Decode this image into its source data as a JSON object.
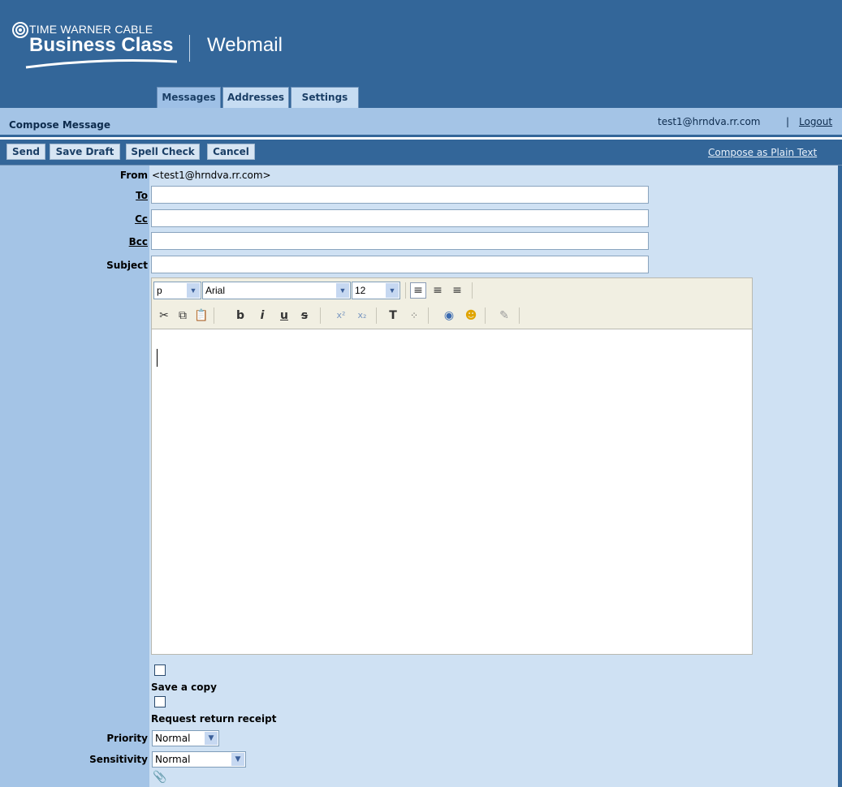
{
  "brand": {
    "line1": "TIME WARNER CABLE",
    "line2": "Business Class",
    "product": "Webmail"
  },
  "tabs": [
    {
      "label": "Messages",
      "active": true
    },
    {
      "label": "Addresses",
      "active": false
    },
    {
      "label": "Settings",
      "active": false
    }
  ],
  "titlebar": {
    "title": "Compose Message",
    "user": "test1@hrndva.rr.com",
    "separator": "|",
    "logout": "Logout"
  },
  "actions": {
    "send": "Send",
    "save_draft": "Save Draft",
    "spell_check": "Spell Check",
    "cancel": "Cancel",
    "plain_text": "Compose as Plain Text"
  },
  "form": {
    "from_label": "From",
    "from_value": "<test1@hrndva.rr.com>",
    "to_label": "To",
    "to_value": "",
    "cc_label": "Cc",
    "cc_value": "",
    "bcc_label": "Bcc",
    "bcc_value": "",
    "subject_label": "Subject",
    "subject_value": ""
  },
  "editor_toolbar": {
    "format": "p",
    "font": "Arial",
    "size": "12",
    "icons": [
      "align-left-icon",
      "align-center-icon",
      "align-right-icon",
      "cut-icon",
      "copy-icon",
      "paste-icon",
      "bold-icon",
      "italic-icon",
      "underline-icon",
      "strikethrough-icon",
      "superscript-icon",
      "subscript-icon",
      "text-color-icon",
      "highlight-icon",
      "insert-link-icon",
      "emoticon-icon",
      "signature-icon"
    ]
  },
  "options": {
    "save_copy": "Save a copy",
    "save_copy_checked": false,
    "return_receipt": "Request return receipt",
    "return_receipt_checked": false,
    "priority_label": "Priority",
    "priority_value": "Normal",
    "sensitivity_label": "Sensitivity",
    "sensitivity_value": "Normal"
  },
  "colors": {
    "header": "#336699",
    "panel": "#a4c4e6",
    "form_bg": "#cfe1f3"
  }
}
